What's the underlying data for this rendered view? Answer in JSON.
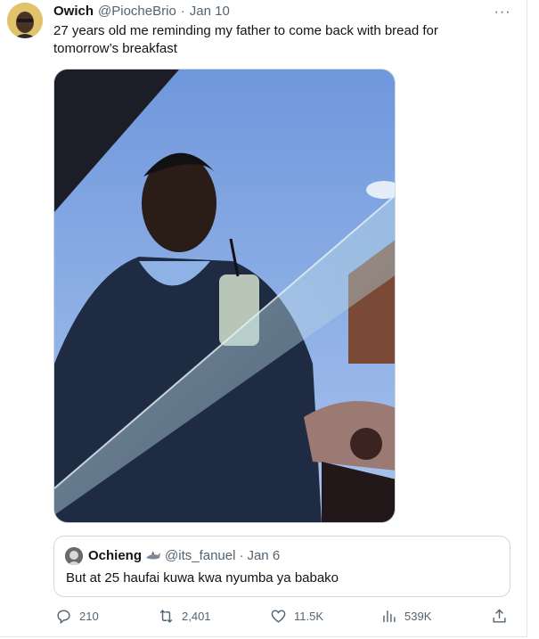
{
  "tweet": {
    "author_name": "Owich",
    "author_handle": "@PiocheBrio",
    "separator": "·",
    "date": "Jan 10",
    "text": "27 years old me reminding my father to come back with bread for tomorrow’s breakfast",
    "more_icon": "more-horizontal-icon",
    "more_label": "···"
  },
  "quoted_tweet": {
    "author_name": "Ochieng",
    "badge_icon": "shark-emoji-icon",
    "author_handle": "@its_fanuel",
    "separator": "·",
    "date": "Jan 6",
    "text": "But at 25 haufai kuwa kwa nyumba ya babako"
  },
  "actions": {
    "replies": "210",
    "retweets": "2,401",
    "likes": "11.5K",
    "views": "539K",
    "icons": [
      "reply-icon",
      "retweet-icon",
      "like-icon",
      "views-icon",
      "share-icon"
    ]
  },
  "colors": {
    "text_primary": "#0f1419",
    "text_secondary": "#536471",
    "border": "#cfd9de",
    "sky": "#7fa3e0"
  }
}
